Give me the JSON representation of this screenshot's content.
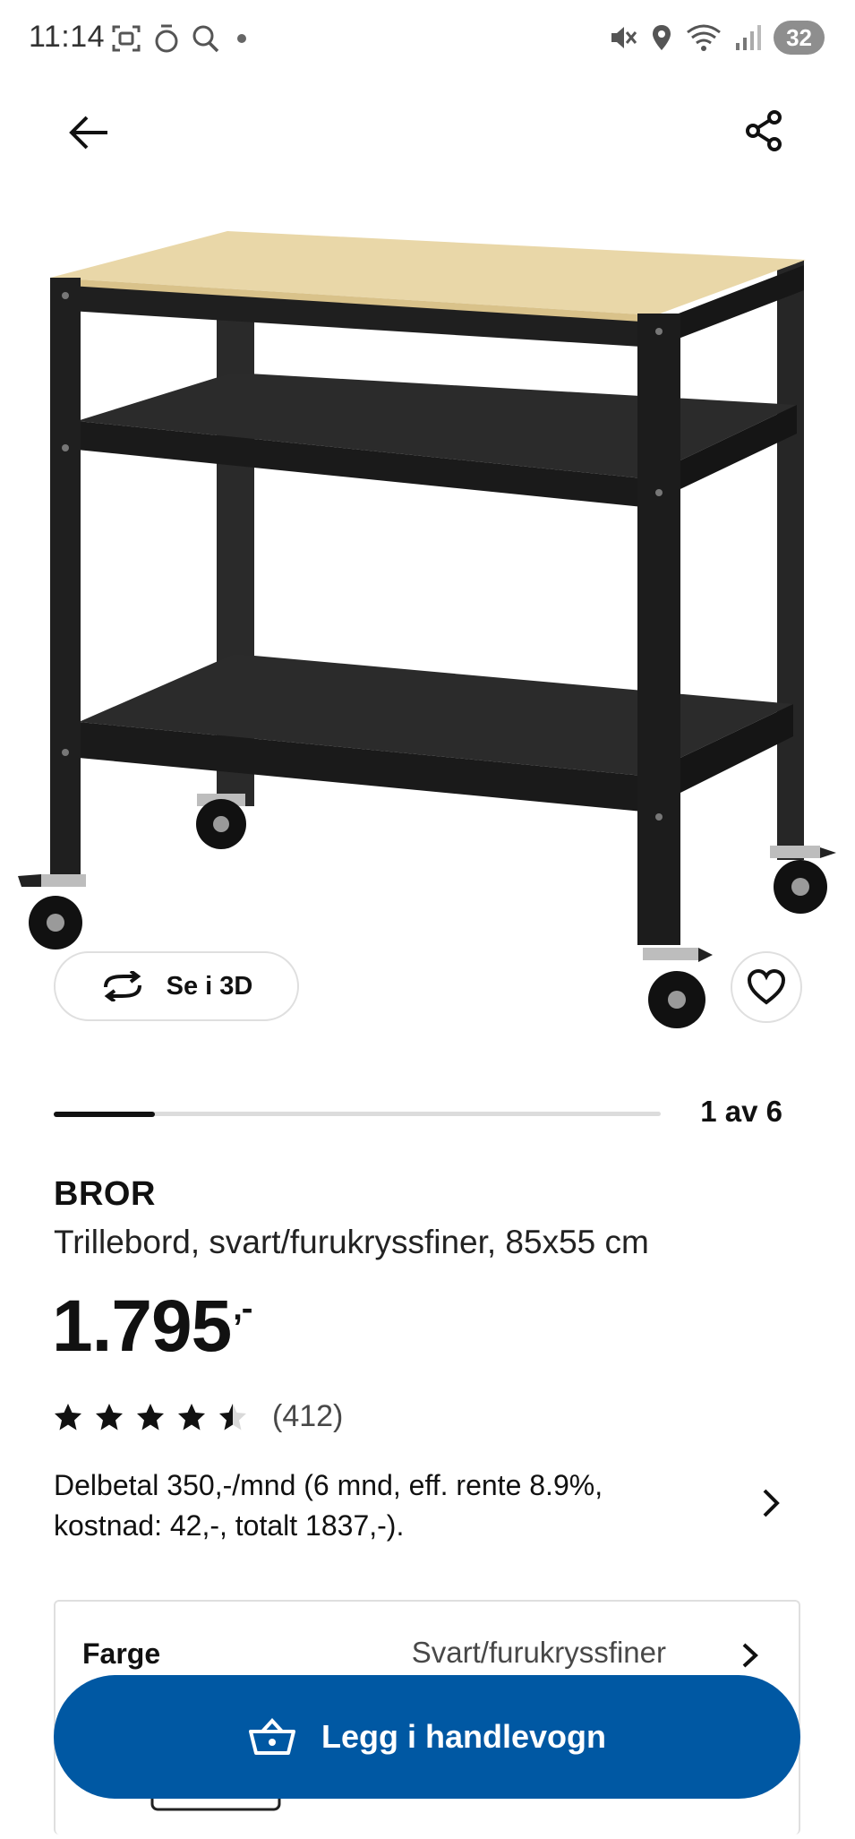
{
  "status_bar": {
    "time": "11:14",
    "battery": "32"
  },
  "product": {
    "brand": "BROR",
    "description": "Trillebord, svart/furukryssfiner, 85x55 cm",
    "price": "1.795",
    "price_suffix": ",-",
    "rating": 4.5,
    "rating_max": 5,
    "review_count": "(412)",
    "installment": "Delbetal 350,-/mnd (6 mnd, eff. rente 8.9%, kostnad: 42,-, totalt 1837,-)."
  },
  "gallery": {
    "view_3d_label": "Se i 3D",
    "counter": "1 av 6",
    "progress": 0.1667
  },
  "options": {
    "color_label": "Farge",
    "color_value": "Svart/furukryssfiner"
  },
  "cart": {
    "add_label": "Legg i handlevogn"
  },
  "colors": {
    "ikea_blue": "#0058a3",
    "wood_top": "#e9d7a8",
    "frame": "#1f1f1f",
    "star": "#111111"
  }
}
